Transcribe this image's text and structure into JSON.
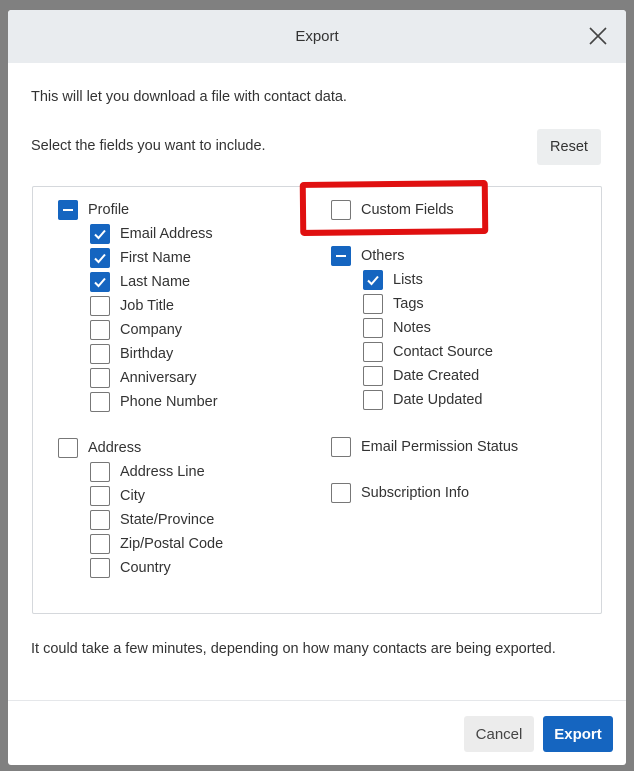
{
  "dialog": {
    "title": "Export",
    "intro": "This will let you download a file with contact data.",
    "select_prompt": "Select the fields you want to include.",
    "reset_label": "Reset",
    "note": "It could take a few minutes, depending on how many contacts are being exported.",
    "cancel_label": "Cancel",
    "export_label": "Export",
    "accent": "#1565c0",
    "annotation_color": "#e01010"
  },
  "fields": {
    "profile": {
      "label": "Profile",
      "state": "partial",
      "children": [
        {
          "label": "Email Address",
          "checked": true
        },
        {
          "label": "First Name",
          "checked": true
        },
        {
          "label": "Last Name",
          "checked": true
        },
        {
          "label": "Job Title",
          "checked": false
        },
        {
          "label": "Company",
          "checked": false
        },
        {
          "label": "Birthday",
          "checked": false
        },
        {
          "label": "Anniversary",
          "checked": false
        },
        {
          "label": "Phone Number",
          "checked": false
        }
      ]
    },
    "address": {
      "label": "Address",
      "state": "unchecked",
      "children": [
        {
          "label": "Address Line",
          "checked": false
        },
        {
          "label": "City",
          "checked": false
        },
        {
          "label": "State/Province",
          "checked": false
        },
        {
          "label": "Zip/Postal Code",
          "checked": false
        },
        {
          "label": "Country",
          "checked": false
        }
      ]
    },
    "custom": {
      "label": "Custom Fields",
      "state": "unchecked"
    },
    "others": {
      "label": "Others",
      "state": "partial",
      "children": [
        {
          "label": "Lists",
          "checked": true
        },
        {
          "label": "Tags",
          "checked": false
        },
        {
          "label": "Notes",
          "checked": false
        },
        {
          "label": "Contact Source",
          "checked": false
        },
        {
          "label": "Date Created",
          "checked": false
        },
        {
          "label": "Date Updated",
          "checked": false
        }
      ]
    },
    "email_permission": {
      "label": "Email Permission Status",
      "state": "unchecked"
    },
    "subscription": {
      "label": "Subscription Info",
      "state": "unchecked"
    }
  }
}
